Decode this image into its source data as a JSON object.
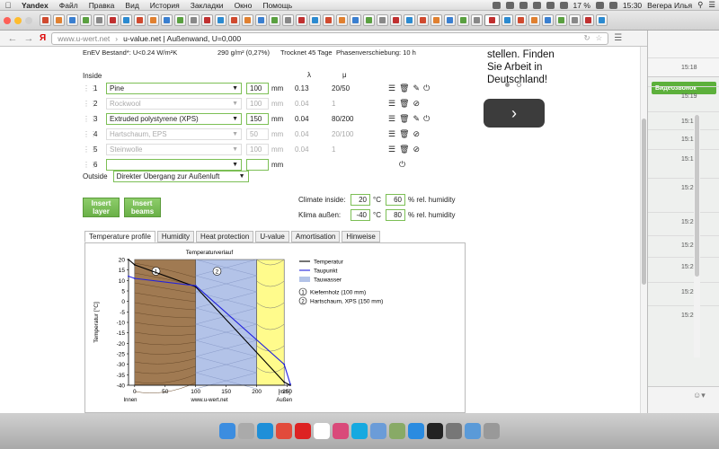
{
  "menubar": {
    "app": "Yandex",
    "items": [
      "Файл",
      "Правка",
      "Вид",
      "История",
      "Закладки",
      "Окно",
      "Помощь"
    ],
    "battery": "17 %",
    "time": "15:30",
    "user": "Вегера Илья"
  },
  "toolbar": {
    "logo": "Я",
    "url_host": "www.u-wert.net",
    "url_sep": "›",
    "url_title": "u-value.net | Außenwand, U=0,000"
  },
  "page": {
    "info": {
      "enev": "EnEV Bestand*: U<0.24 W/m²K",
      "mass": "290 g/m² (0,27%)",
      "dry": "Trocknet 45 Tage",
      "phase": "Phasenverschiebung: 10 h"
    },
    "inside_label": "Inside",
    "lambda_header": "λ",
    "mu_header": "μ",
    "unit_mm": "mm",
    "layers": [
      {
        "num": "1",
        "material": "Pine",
        "thickness": "100",
        "lambda": "0.13",
        "mu": "20/50",
        "enabled": true
      },
      {
        "num": "2",
        "material": "Rockwool",
        "thickness": "100",
        "lambda": "0.04",
        "mu": "1",
        "enabled": false
      },
      {
        "num": "3",
        "material": "Extruded polystyrene (XPS)",
        "thickness": "150",
        "lambda": "0.04",
        "mu": "80/200",
        "enabled": true
      },
      {
        "num": "4",
        "material": "Hartschaum, EPS",
        "thickness": "50",
        "lambda": "0.04",
        "mu": "20/100",
        "enabled": false
      },
      {
        "num": "5",
        "material": "Steinwolle",
        "thickness": "100",
        "lambda": "0.04",
        "mu": "1",
        "enabled": false
      },
      {
        "num": "6",
        "material": "",
        "thickness": "",
        "lambda": "",
        "mu": "",
        "enabled": true
      }
    ],
    "outside_label": "Outside",
    "outside_value": "Direkter Übergang zur Außenluft",
    "insert_layer": "Insert layer",
    "insert_beams": "Insert beams",
    "climate_inside_label": "Climate inside:",
    "climate_inside_temp": "20",
    "climate_inside_hum": "60",
    "climate_outside_label": "Klima außen:",
    "climate_outside_temp": "-40",
    "climate_outside_hum": "80",
    "deg_c": "°C",
    "rel_hum": "% rel. humidity",
    "tabs": [
      "Temperature profile",
      "Humidity",
      "Heat protection",
      "U-value",
      "Amortisation",
      "Hinweise"
    ]
  },
  "chart_data": {
    "type": "line",
    "title": "Temperaturverlauf",
    "ylabel": "Temperatur [°C]",
    "xlabel": "[mm]",
    "x_left_label": "Innen",
    "x_right_label": "Außen",
    "footer": "www.u-wert.net",
    "xlim": [
      -10,
      255
    ],
    "ylim": [
      -40,
      20
    ],
    "x_ticks": [
      0,
      50,
      100,
      150,
      200,
      250
    ],
    "y_ticks": [
      20,
      15,
      10,
      5,
      0,
      -5,
      -10,
      -15,
      -20,
      -25,
      -30,
      -35,
      -40
    ],
    "layers": [
      {
        "marker": "1",
        "from": 0,
        "to": 100,
        "color": "#a07a52"
      },
      {
        "marker": "2",
        "from": 100,
        "to": 200,
        "color": "#b3c3e8"
      },
      {
        "marker": "",
        "from": 200,
        "to": 245,
        "color": "#fffb8c"
      }
    ],
    "series": [
      {
        "name": "Temperatur",
        "color": "#000000",
        "x": [
          -10,
          0,
          100,
          245,
          255
        ],
        "y": [
          20,
          17.5,
          7,
          -38.5,
          -40
        ]
      },
      {
        "name": "Taupunkt",
        "color": "#2222dd",
        "x": [
          -10,
          0,
          100,
          245,
          255
        ],
        "y": [
          12,
          11,
          7.5,
          -30,
          -39.5
        ]
      }
    ],
    "legend": [
      {
        "label": "Temperatur",
        "kind": "line",
        "color": "#000000"
      },
      {
        "label": "Taupunkt",
        "kind": "line",
        "color": "#2222dd"
      },
      {
        "label": "Tauwasser",
        "kind": "box",
        "color": "#b3c3e8"
      }
    ],
    "legend_notes": [
      {
        "marker": "1",
        "label": "Kiefernholz (100 mm)"
      },
      {
        "marker": "2",
        "label": "Hartschaum, XPS (150 mm)"
      }
    ]
  },
  "ad": {
    "text_lines": [
      "stellen. Finden",
      "Sie Arbeit in",
      "Deutschland!"
    ],
    "next": "›"
  },
  "rightwin": {
    "call_button": "Видеозвонок",
    "times": [
      "15:18",
      "15:19",
      "15:19",
      "15:19",
      "15:19",
      "15:20",
      "15:20",
      "15:20",
      "15:20",
      "15:20",
      "15:20"
    ]
  },
  "dock": {
    "items": [
      "finder-icon",
      "launchpad-icon",
      "safari-icon",
      "chrome-icon",
      "yandex-icon",
      "ical-icon",
      "itunes-icon",
      "skype-icon",
      "mail-icon",
      "photos-icon",
      "appstore-icon",
      "terminal-icon",
      "settings-icon",
      "folder-icon",
      "trash-icon"
    ]
  }
}
